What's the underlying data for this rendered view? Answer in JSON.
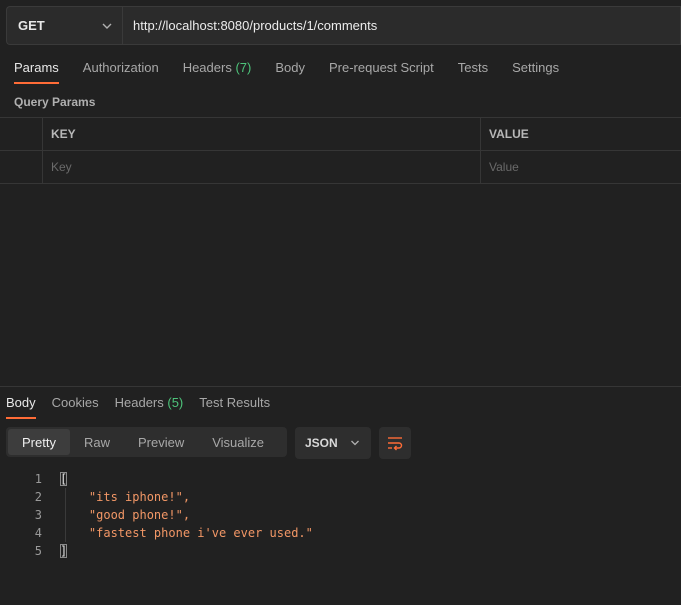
{
  "request": {
    "method": "GET",
    "url": "http://localhost:8080/products/1/comments"
  },
  "request_tabs": [
    {
      "label": "Params",
      "count": "",
      "active": true
    },
    {
      "label": "Authorization",
      "count": ""
    },
    {
      "label": "Headers",
      "count": "(7)"
    },
    {
      "label": "Body",
      "count": ""
    },
    {
      "label": "Pre-request Script",
      "count": ""
    },
    {
      "label": "Tests",
      "count": ""
    },
    {
      "label": "Settings",
      "count": ""
    }
  ],
  "query_params": {
    "title": "Query Params",
    "key_header": "KEY",
    "value_header": "VALUE",
    "key_placeholder": "Key",
    "value_placeholder": "Value"
  },
  "response_tabs": [
    {
      "label": "Body",
      "count": "",
      "active": true
    },
    {
      "label": "Cookies",
      "count": ""
    },
    {
      "label": "Headers",
      "count": "(5)"
    },
    {
      "label": "Test Results",
      "count": ""
    }
  ],
  "view_modes": [
    "Pretty",
    "Raw",
    "Preview",
    "Visualize"
  ],
  "format": "JSON",
  "code_lines": [
    {
      "num": "1",
      "text": "["
    },
    {
      "num": "2",
      "text": "    \"its iphone!\","
    },
    {
      "num": "3",
      "text": "    \"good phone!\","
    },
    {
      "num": "4",
      "text": "    \"fastest phone i've ever used.\""
    },
    {
      "num": "5",
      "text": "]"
    }
  ],
  "colors": {
    "accent": "#ff6c37",
    "count": "#4dc37a",
    "string": "#f29766"
  }
}
